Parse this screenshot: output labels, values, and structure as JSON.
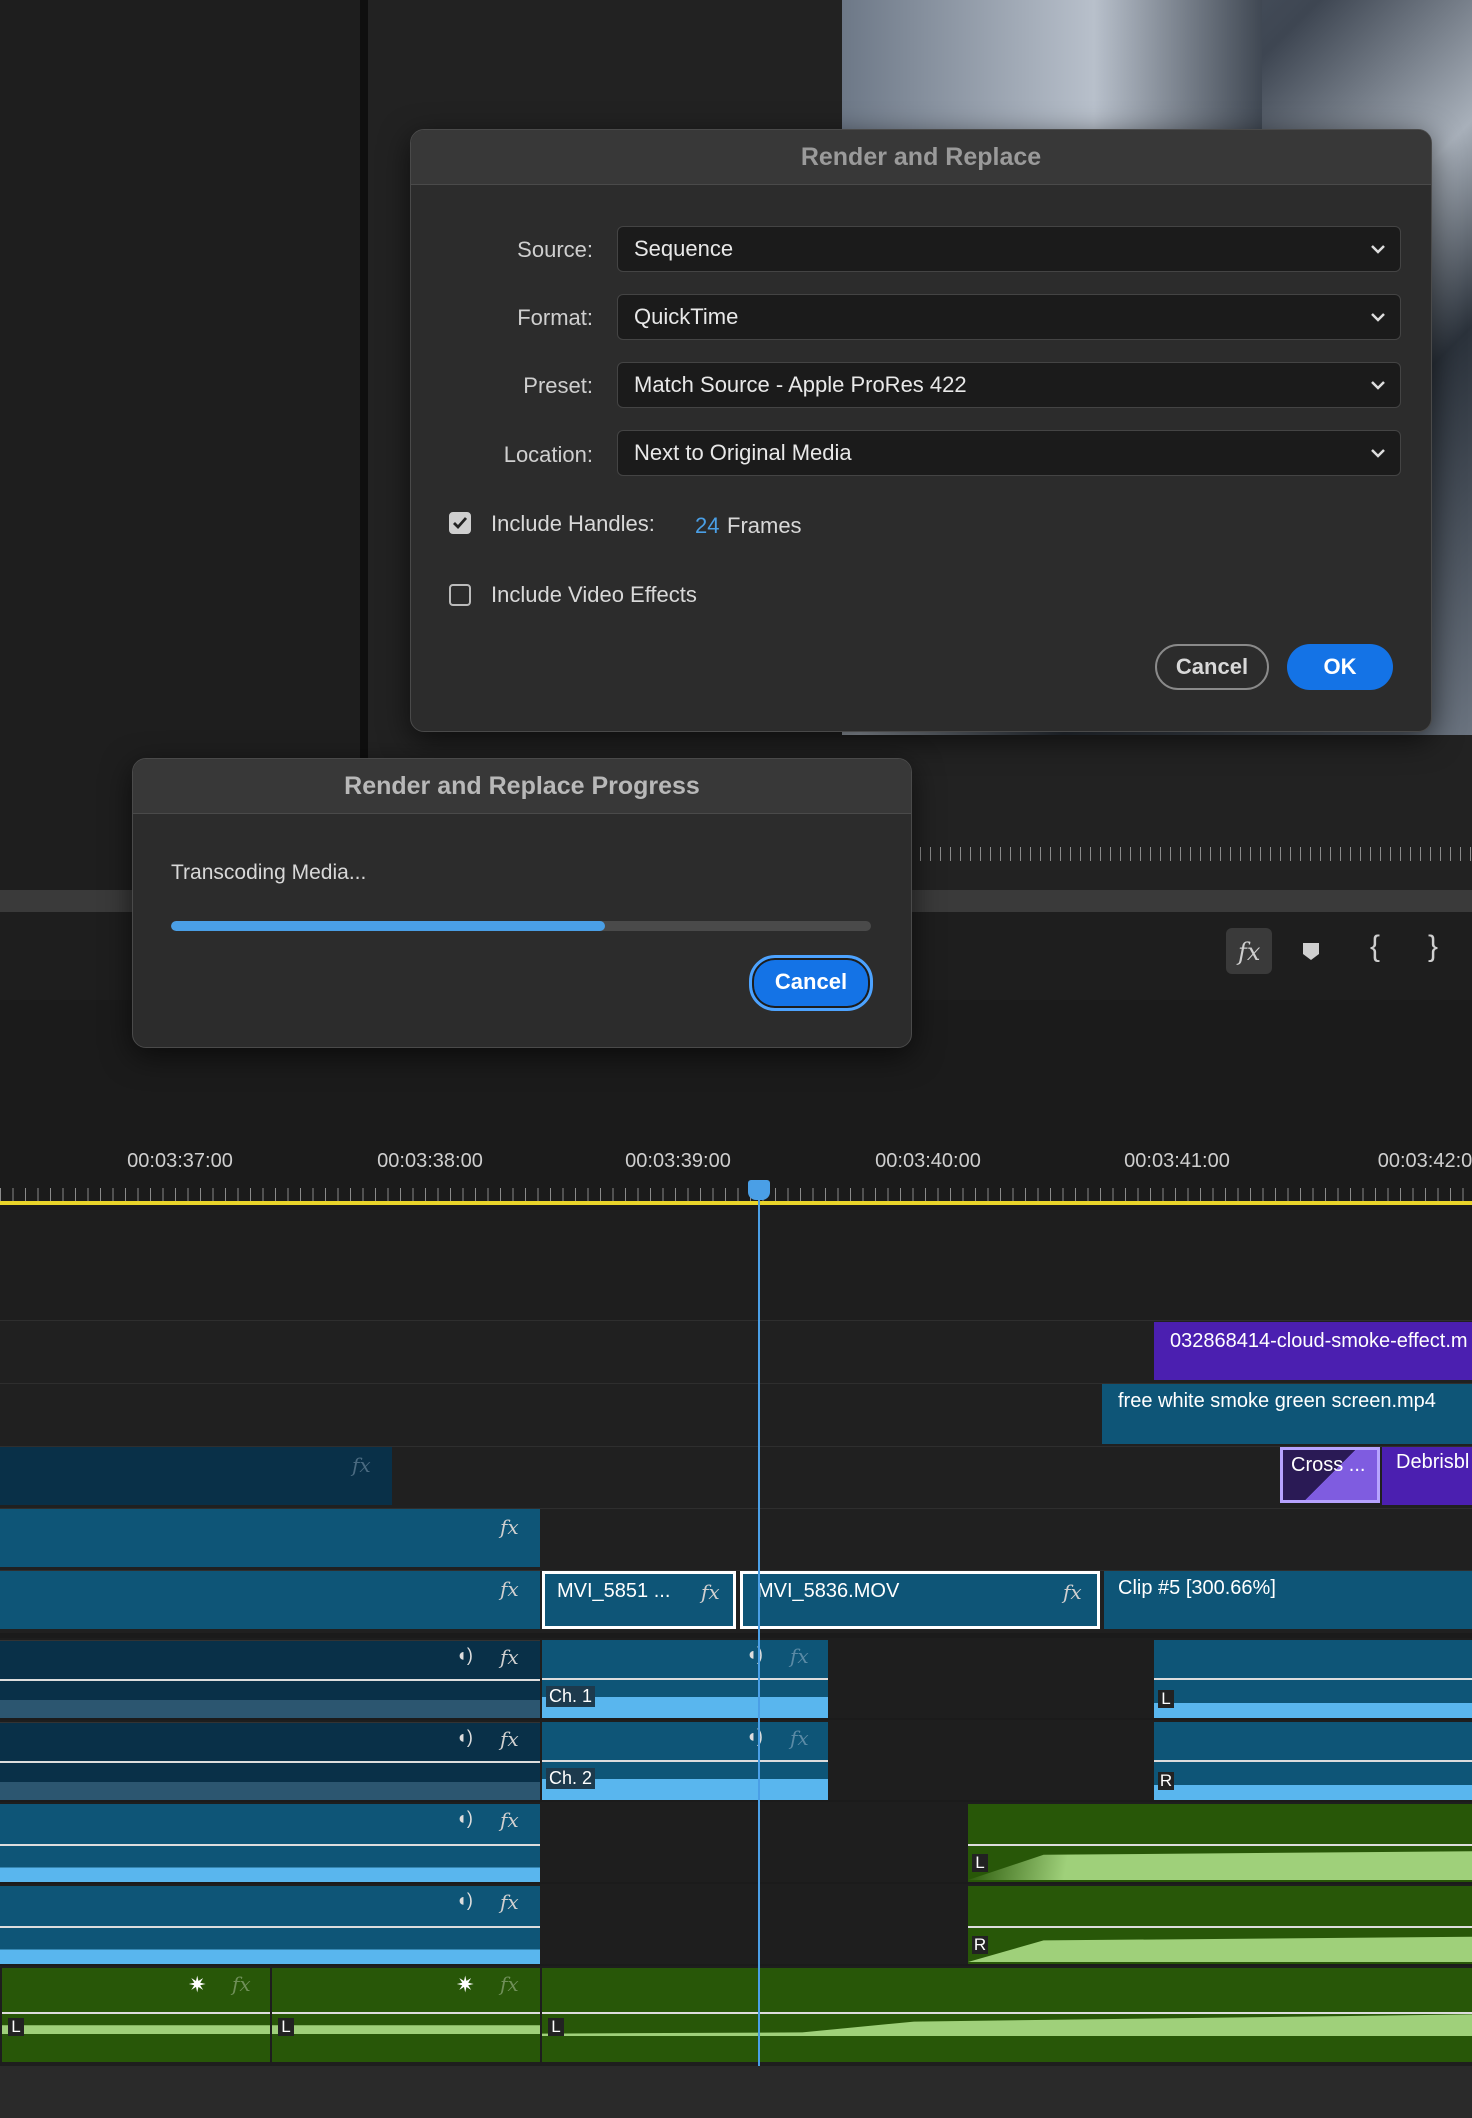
{
  "render_dialog": {
    "title": "Render and Replace",
    "source_label": "Source:",
    "source_value": "Sequence",
    "format_label": "Format:",
    "format_value": "QuickTime",
    "preset_label": "Preset:",
    "preset_value": "Match Source - Apple ProRes 422",
    "location_label": "Location:",
    "location_value": "Next to Original Media",
    "include_handles_label": "Include Handles:",
    "include_handles_checked": true,
    "handles_value": "24",
    "handles_unit": "Frames",
    "include_effects_label": "Include Video Effects",
    "include_effects_checked": false,
    "cancel_label": "Cancel",
    "ok_label": "OK"
  },
  "progress_dialog": {
    "title": "Render and Replace Progress",
    "status": "Transcoding Media...",
    "progress": 0.62,
    "cancel_label": "Cancel"
  },
  "timeline": {
    "timecodes": [
      "00:03:37:00",
      "00:03:38:00",
      "00:03:39:00",
      "00:03:40:00",
      "00:03:41:00",
      "00:03:42:0"
    ],
    "clips": {
      "cloud_smoke": "032868414-cloud-smoke-effect.m",
      "white_smoke": "free white smoke green screen.mp4",
      "cross": "Cross ...",
      "debris": "Debrisbl",
      "mvi_5851": "MVI_5851 ...",
      "mvi_5836": "MVI_5836.MOV",
      "clip5": "Clip #5 [300.66%]"
    },
    "channel_labels": {
      "ch1": "Ch. 1",
      "ch2": "Ch. 2",
      "L": "L",
      "R": "R"
    },
    "fx": "fx"
  },
  "colors": {
    "accent": "#1473e6",
    "progress_fill": "#4a9fe6",
    "playhead": "#4a9fe6",
    "work_area": "#e8d32a",
    "video_clip": "#0e5577",
    "audio_green": "#285708",
    "purple_clip": "#4b1fb0"
  }
}
